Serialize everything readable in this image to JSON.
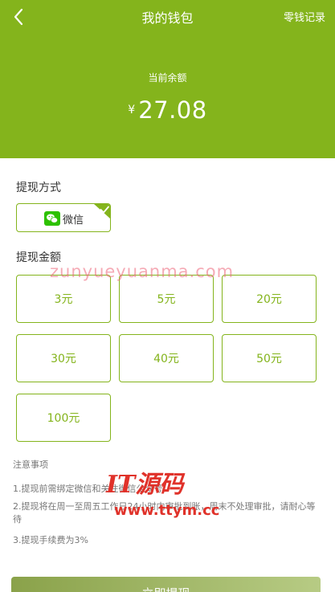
{
  "header": {
    "title": "我的钱包",
    "records_link": "零钱记录",
    "balance_label": "当前余额",
    "currency": "¥",
    "balance": "27.08"
  },
  "withdraw_method": {
    "section_title": "提现方式",
    "option_label": "微信",
    "selected": true
  },
  "withdraw_amount": {
    "section_title": "提现金额",
    "options": [
      "3元",
      "5元",
      "20元",
      "30元",
      "40元",
      "50元",
      "100元"
    ]
  },
  "notes": {
    "title": "注意事项",
    "items": [
      "1.提现前需绑定微信和关注微信公众号",
      "2.提现将在周一至周五工作日24小时内审批到账，周末不处理审批，请耐心等待",
      "3.提现手续费为3%"
    ]
  },
  "submit_label": "立即提现",
  "watermarks": {
    "url_text": "zunyueyuanma.com",
    "brand_text": "IT源码",
    "brand_url": "www.ttym.cc"
  },
  "colors": {
    "primary": "#84b41c",
    "muted_text": "#777777"
  }
}
